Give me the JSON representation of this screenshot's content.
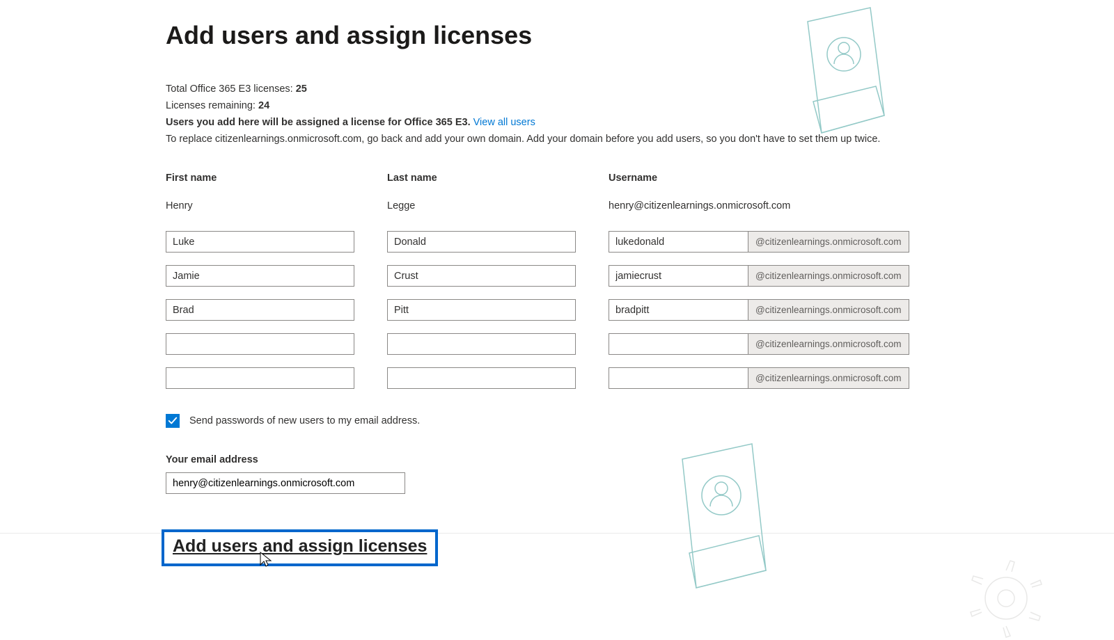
{
  "title": "Add users and assign licenses",
  "info": {
    "total_label": "Total Office 365 E3 licenses: ",
    "total_value": "25",
    "remaining_label": "Licenses remaining: ",
    "remaining_value": "24",
    "assign_text": "Users you add here will be assigned a license for Office 365 E3. ",
    "view_all": "View all users",
    "replace_text": "To replace citizenlearnings.onmicrosoft.com, go back and add your own domain. Add your domain before you add users, so you don't have to set them up twice."
  },
  "headers": {
    "first": "First name",
    "last": "Last name",
    "user": "Username"
  },
  "static_row": {
    "first": "Henry",
    "last": "Legge",
    "user": "henry@citizenlearnings.onmicrosoft.com"
  },
  "domain_suffix": "@citizenlearnings.onmicrosoft.com",
  "rows": {
    "r1": {
      "first": "Luke",
      "last": "Donald",
      "user": "lukedonald"
    },
    "r2": {
      "first": "Jamie",
      "last": "Crust",
      "user": "jamiecrust"
    },
    "r3": {
      "first": "Brad",
      "last": "Pitt",
      "user": "bradpitt"
    },
    "r4": {
      "first": "",
      "last": "",
      "user": ""
    },
    "r5": {
      "first": "",
      "last": "",
      "user": ""
    }
  },
  "checkbox_label": "Send passwords of new users to my email address.",
  "email": {
    "label": "Your email address",
    "value": "henry@citizenlearnings.onmicrosoft.com"
  },
  "primary_button": "Add users and assign licenses"
}
